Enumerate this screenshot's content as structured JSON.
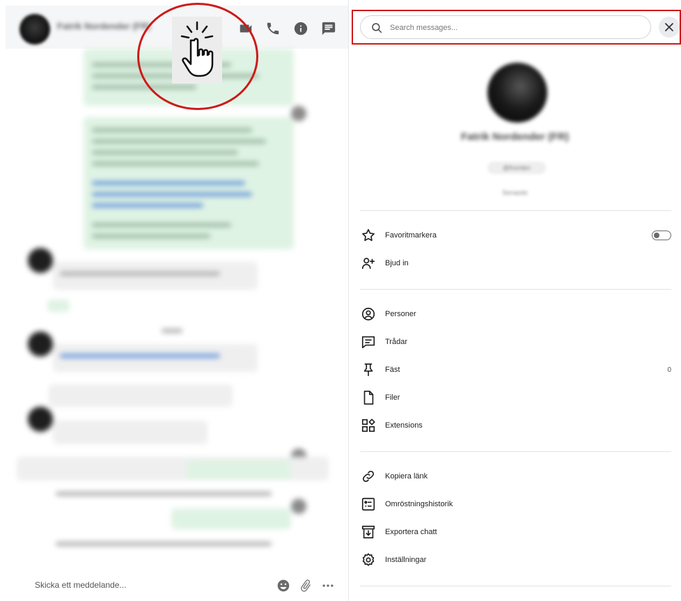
{
  "chat": {
    "title": "Fatrik Nordender (FR)",
    "composer_placeholder": "Skicka ett meddelande..."
  },
  "search": {
    "placeholder": "Search messages..."
  },
  "profile": {
    "name": "Fatrik Nordender (FR)",
    "handle": "@fnorden",
    "status": "Senaste"
  },
  "menu": {
    "group1": [
      {
        "icon": "star-icon",
        "label": "Favoritmarkera"
      },
      {
        "icon": "add-person-icon",
        "label": "Bjud in"
      }
    ],
    "group2": [
      {
        "icon": "person-circle-icon",
        "label": "Personer"
      },
      {
        "icon": "threads-icon",
        "label": "Trådar"
      },
      {
        "icon": "pin-icon",
        "label": "Fäst",
        "count": "0"
      },
      {
        "icon": "file-icon",
        "label": "Filer"
      },
      {
        "icon": "extensions-icon",
        "label": "Extensions"
      }
    ],
    "group3": [
      {
        "icon": "link-icon",
        "label": "Kopiera länk"
      },
      {
        "icon": "poll-history-icon",
        "label": "Omröstningshistorik"
      },
      {
        "icon": "export-icon",
        "label": "Exportera chatt"
      },
      {
        "icon": "gear-icon",
        "label": "Inställningar"
      }
    ]
  },
  "colors": {
    "highlight_red": "#cc1a1a",
    "bubble_green": "#dff3e4"
  }
}
